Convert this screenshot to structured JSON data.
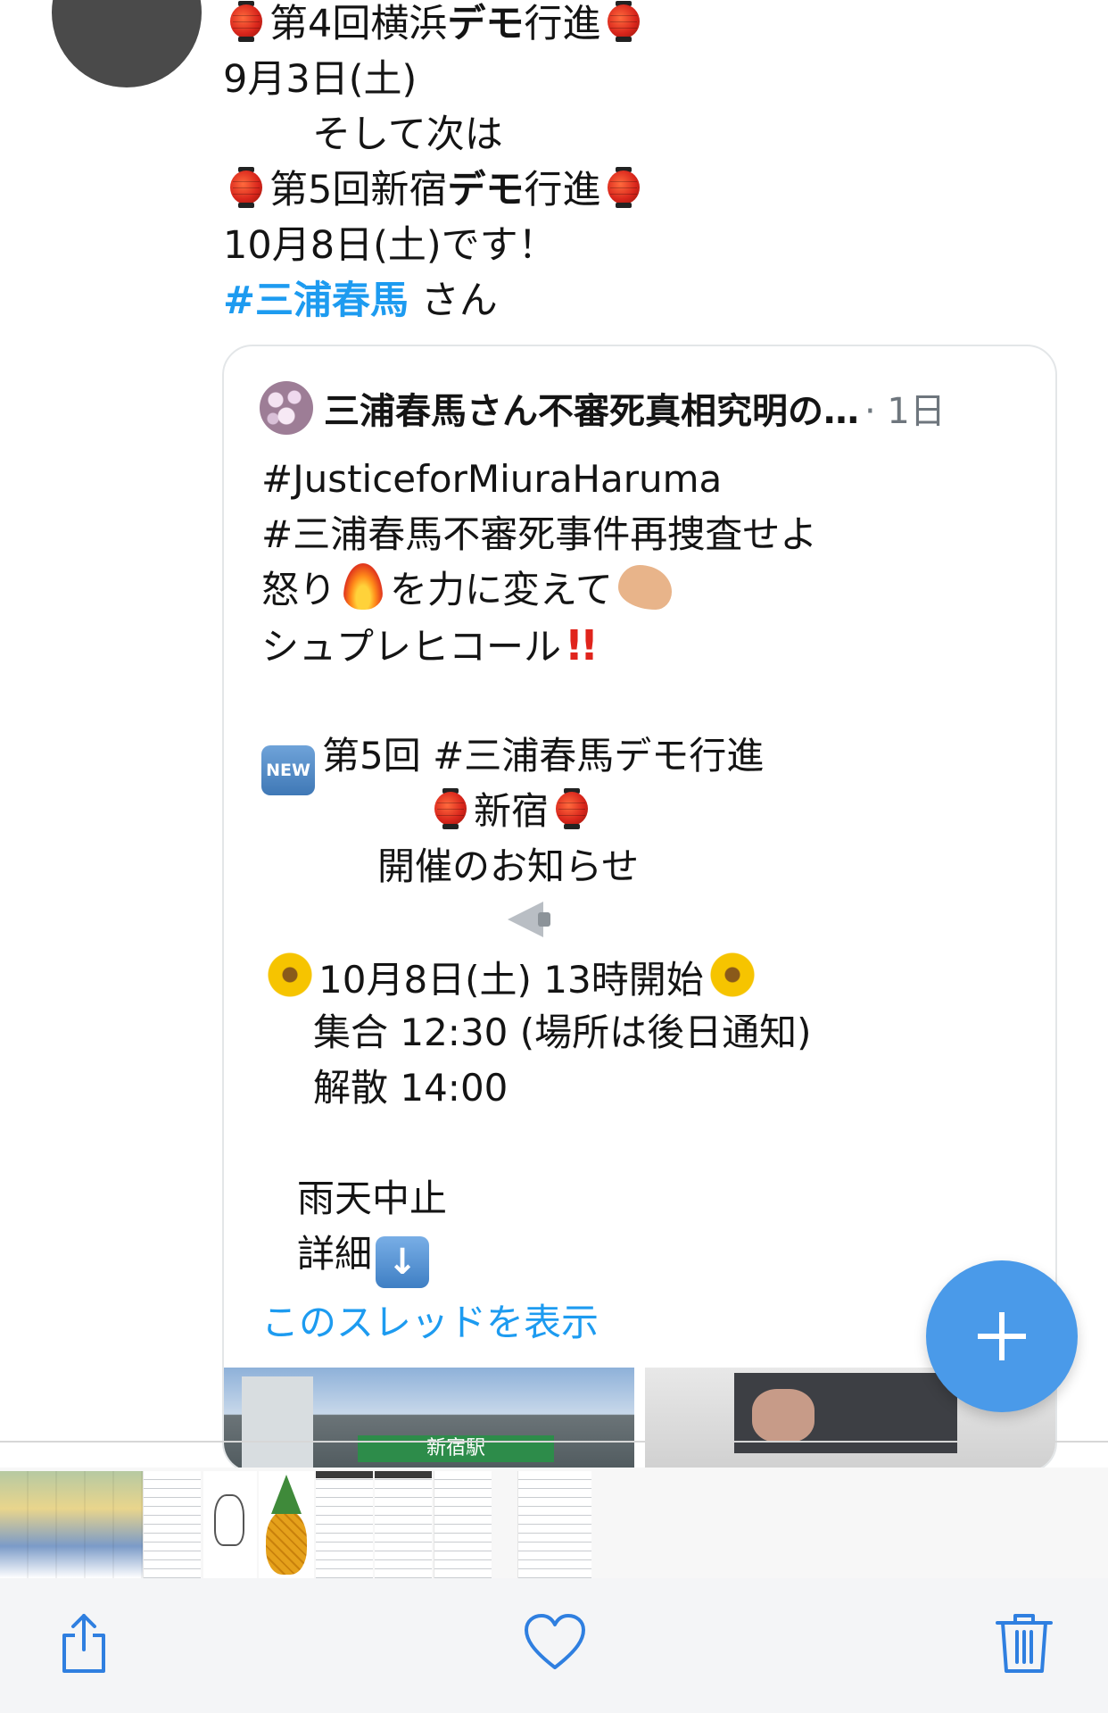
{
  "tweet": {
    "lines": [
      {
        "pre": "第4回横浜",
        "bold": "デモ",
        "post": "行進"
      },
      {
        "text": "9月3日(土)"
      },
      {
        "text": "そして次は"
      },
      {
        "pre": "第5回新宿",
        "bold": "デモ",
        "post": "行進"
      },
      {
        "text": "10月8日(土)です！"
      },
      {
        "hashtag": "#三浦春馬",
        "post": " さん"
      }
    ]
  },
  "quote": {
    "author": "三浦春馬さん不審死真相究明の…",
    "time": "· 1日",
    "lines": [
      "#JusticeforMiuraHaruma",
      "#三浦春馬不審死事件再捜査せよ",
      "怒り",
      "を力に変えて",
      "シュプレヒコール",
      "第5回 #三浦春馬デモ行進",
      "新宿",
      "開催のお知らせ",
      "10月8日(土) 13時開始",
      "集合 12:30  (場所は後日通知)",
      "解散 14:00",
      "雨天中止",
      "詳細"
    ],
    "new_badge": "NEW",
    "bangbang": "!!",
    "show_thread": "このスレッドを表示",
    "media_sign": "新宿駅"
  },
  "icons": {
    "compose": "plus-icon",
    "share": "share-icon",
    "favorite": "heart-icon",
    "delete": "trash-icon"
  },
  "colors": {
    "accent": "#1d9bf0",
    "fab": "#4a9ae9",
    "toolbar_icon": "#2f7fe0"
  }
}
